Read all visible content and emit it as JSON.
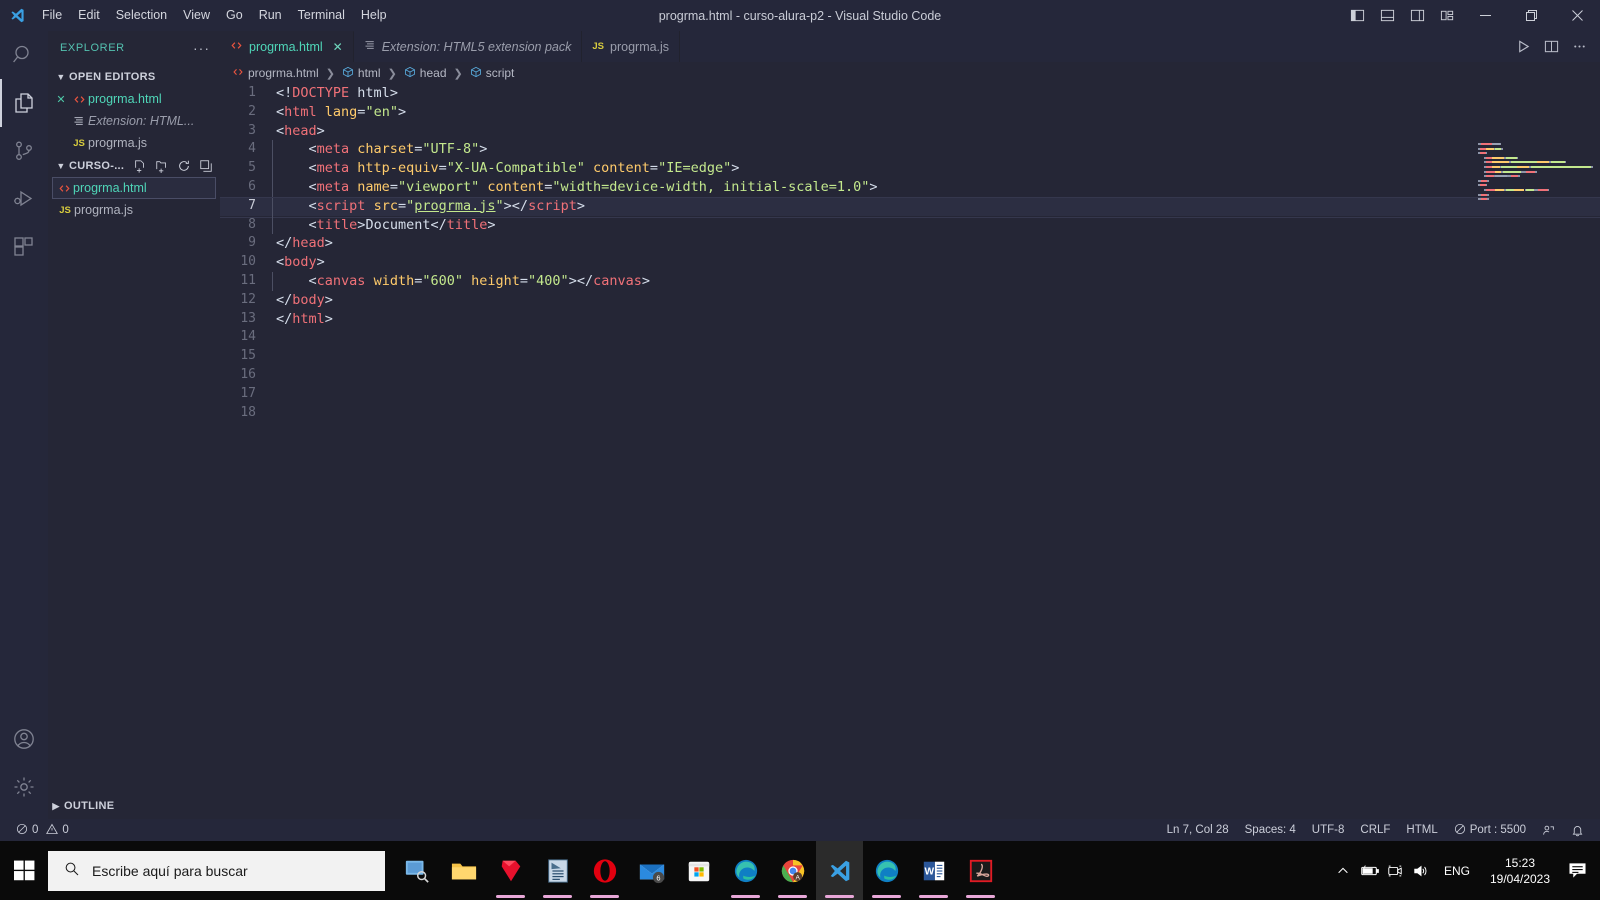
{
  "titlebar": {
    "title": "progrma.html - curso-alura-p2 - Visual Studio Code",
    "menu": [
      "File",
      "Edit",
      "Selection",
      "View",
      "Go",
      "Run",
      "Terminal",
      "Help"
    ],
    "layout_icons": [
      "toggle-primary-sidebar-icon",
      "toggle-panel-icon",
      "toggle-secondary-sidebar-icon",
      "customize-layout-icon"
    ],
    "window_controls": {
      "minimize": "—",
      "maximize": "❐",
      "close": "✕"
    }
  },
  "activitybar": {
    "items": [
      {
        "name": "search-icon",
        "label": "Search"
      },
      {
        "name": "explorer-icon",
        "label": "Explorer"
      },
      {
        "name": "source-control-icon",
        "label": "Source Control"
      },
      {
        "name": "run-and-debug-icon",
        "label": "Run and Debug"
      },
      {
        "name": "extensions-icon",
        "label": "Extensions"
      }
    ],
    "bottom": [
      {
        "name": "accounts-icon",
        "label": "Accounts"
      },
      {
        "name": "manage-settings-icon",
        "label": "Manage"
      }
    ]
  },
  "sidebar": {
    "header": "EXPLORER",
    "more_actions": "···",
    "open_editors": {
      "label": "OPEN EDITORS",
      "items": [
        {
          "name": "progrma.html",
          "icon": "html5-icon",
          "closable": true,
          "style": "html"
        },
        {
          "name": "Extension: HTML...",
          "icon": "extension-icon",
          "closable": false,
          "style": "ext"
        },
        {
          "name": "progrma.js",
          "icon": "js-icon",
          "closable": false,
          "style": "js"
        }
      ]
    },
    "folder": {
      "label": "CURSO-...",
      "actions": [
        "new-file-icon",
        "new-folder-icon",
        "refresh-icon",
        "collapse-all-icon"
      ],
      "files": [
        {
          "name": "progrma.html",
          "icon": "html5-icon",
          "selected": true,
          "style": "html"
        },
        {
          "name": "progrma.js",
          "icon": "js-icon",
          "selected": false,
          "style": "js"
        }
      ]
    },
    "outline": "OUTLINE"
  },
  "tabs": [
    {
      "label": "progrma.html",
      "icon": "html5-icon",
      "active": true,
      "dirty": false,
      "closable": true,
      "italic": false
    },
    {
      "label": "Extension: HTML5 extension pack",
      "icon": "extension-icon",
      "active": false,
      "closable": false,
      "italic": true
    },
    {
      "label": "progrma.js",
      "icon": "js-icon",
      "active": false,
      "closable": false,
      "italic": false
    }
  ],
  "tab_actions": [
    "run-code-icon",
    "split-editor-right-icon",
    "more-actions-icon"
  ],
  "breadcrumb": [
    {
      "label": "progrma.html",
      "icon": "html5-icon"
    },
    {
      "label": "html",
      "icon": "symbol-field-icon"
    },
    {
      "label": "head",
      "icon": "symbol-field-icon"
    },
    {
      "label": "script",
      "icon": "symbol-field-icon"
    }
  ],
  "code": {
    "active_line": 7,
    "lines": [
      {
        "n": 1,
        "tokens": [
          {
            "t": "punct",
            "v": "<!"
          },
          {
            "t": "doct",
            "v": "DOCTYPE"
          },
          {
            "t": "txt",
            "v": " html"
          },
          {
            "t": "punct",
            "v": ">"
          }
        ]
      },
      {
        "n": 2,
        "tokens": [
          {
            "t": "punct",
            "v": "<"
          },
          {
            "t": "tag",
            "v": "html"
          },
          {
            "t": "attr",
            "v": " lang"
          },
          {
            "t": "punct",
            "v": "="
          },
          {
            "t": "str",
            "v": "\"en\""
          },
          {
            "t": "punct",
            "v": ">"
          }
        ]
      },
      {
        "n": 3,
        "tokens": [
          {
            "t": "punct",
            "v": "<"
          },
          {
            "t": "tag",
            "v": "head"
          },
          {
            "t": "punct",
            "v": ">"
          }
        ]
      },
      {
        "n": 4,
        "indent": 1,
        "tokens": [
          {
            "t": "txt",
            "v": "    "
          },
          {
            "t": "punct",
            "v": "<"
          },
          {
            "t": "tag",
            "v": "meta"
          },
          {
            "t": "attr",
            "v": " charset"
          },
          {
            "t": "punct",
            "v": "="
          },
          {
            "t": "str",
            "v": "\"UTF-8\""
          },
          {
            "t": "punct",
            "v": ">"
          }
        ]
      },
      {
        "n": 5,
        "indent": 1,
        "tokens": [
          {
            "t": "txt",
            "v": "    "
          },
          {
            "t": "punct",
            "v": "<"
          },
          {
            "t": "tag",
            "v": "meta"
          },
          {
            "t": "attr",
            "v": " http-equiv"
          },
          {
            "t": "punct",
            "v": "="
          },
          {
            "t": "str",
            "v": "\"X-UA-Compatible\""
          },
          {
            "t": "attr",
            "v": " content"
          },
          {
            "t": "punct",
            "v": "="
          },
          {
            "t": "str",
            "v": "\"IE=edge\""
          },
          {
            "t": "punct",
            "v": ">"
          }
        ]
      },
      {
        "n": 6,
        "indent": 1,
        "tokens": [
          {
            "t": "txt",
            "v": "    "
          },
          {
            "t": "punct",
            "v": "<"
          },
          {
            "t": "tag",
            "v": "meta"
          },
          {
            "t": "attr",
            "v": " name"
          },
          {
            "t": "punct",
            "v": "="
          },
          {
            "t": "str",
            "v": "\"viewport\""
          },
          {
            "t": "attr",
            "v": " content"
          },
          {
            "t": "punct",
            "v": "="
          },
          {
            "t": "str",
            "v": "\"width=device-width, initial-scale=1.0\""
          },
          {
            "t": "punct",
            "v": ">"
          }
        ]
      },
      {
        "n": 7,
        "indent": 1,
        "tokens": [
          {
            "t": "txt",
            "v": "    "
          },
          {
            "t": "punct",
            "v": "<"
          },
          {
            "t": "tag",
            "v": "script"
          },
          {
            "t": "attr",
            "v": " src"
          },
          {
            "t": "punct",
            "v": "="
          },
          {
            "t": "str",
            "v": "\""
          },
          {
            "t": "link",
            "v": "progrma.js"
          },
          {
            "t": "str",
            "v": "\""
          },
          {
            "t": "punct",
            "v": ">"
          },
          {
            "t": "punct",
            "v": "</"
          },
          {
            "t": "tag",
            "v": "script"
          },
          {
            "t": "punct",
            "v": ">"
          }
        ]
      },
      {
        "n": 8,
        "indent": 1,
        "tokens": [
          {
            "t": "txt",
            "v": "    "
          },
          {
            "t": "punct",
            "v": "<"
          },
          {
            "t": "tag",
            "v": "title"
          },
          {
            "t": "punct",
            "v": ">"
          },
          {
            "t": "txt",
            "v": "Document"
          },
          {
            "t": "punct",
            "v": "</"
          },
          {
            "t": "tag",
            "v": "title"
          },
          {
            "t": "punct",
            "v": ">"
          }
        ]
      },
      {
        "n": 9,
        "tokens": [
          {
            "t": "punct",
            "v": "</"
          },
          {
            "t": "tag",
            "v": "head"
          },
          {
            "t": "punct",
            "v": ">"
          }
        ]
      },
      {
        "n": 10,
        "tokens": [
          {
            "t": "punct",
            "v": "<"
          },
          {
            "t": "tag",
            "v": "body"
          },
          {
            "t": "punct",
            "v": ">"
          }
        ]
      },
      {
        "n": 11,
        "indent": 1,
        "tokens": [
          {
            "t": "txt",
            "v": "    "
          },
          {
            "t": "punct",
            "v": "<"
          },
          {
            "t": "tag",
            "v": "canvas"
          },
          {
            "t": "attr",
            "v": " width"
          },
          {
            "t": "punct",
            "v": "="
          },
          {
            "t": "str",
            "v": "\"600\""
          },
          {
            "t": "attr",
            "v": " height"
          },
          {
            "t": "punct",
            "v": "="
          },
          {
            "t": "str",
            "v": "\"400\""
          },
          {
            "t": "punct",
            "v": ">"
          },
          {
            "t": "punct",
            "v": "</"
          },
          {
            "t": "tag",
            "v": "canvas"
          },
          {
            "t": "punct",
            "v": ">"
          }
        ]
      },
      {
        "n": 12,
        "tokens": [
          {
            "t": "punct",
            "v": "</"
          },
          {
            "t": "tag",
            "v": "body"
          },
          {
            "t": "punct",
            "v": ">"
          }
        ]
      },
      {
        "n": 13,
        "tokens": [
          {
            "t": "punct",
            "v": "</"
          },
          {
            "t": "tag",
            "v": "html"
          },
          {
            "t": "punct",
            "v": ">"
          }
        ]
      },
      {
        "n": 14,
        "tokens": []
      },
      {
        "n": 15,
        "tokens": []
      },
      {
        "n": 16,
        "tokens": []
      },
      {
        "n": 17,
        "tokens": []
      },
      {
        "n": 18,
        "tokens": []
      }
    ]
  },
  "statusbar": {
    "errors": "0",
    "warnings": "0",
    "position": "Ln 7, Col 28",
    "spaces": "Spaces: 4",
    "encoding": "UTF-8",
    "eol": "CRLF",
    "language": "HTML",
    "live_server": "Port : 5500",
    "remote_icon": "remote-window-icon",
    "bell_icon": "notifications-bell-icon"
  },
  "taskbar": {
    "start": "windows-start-icon",
    "search_placeholder": "Escribe aquí para buscar",
    "apps": [
      {
        "name": "task-view-icon",
        "running": false,
        "focused": false
      },
      {
        "name": "file-explorer-icon",
        "running": false,
        "focused": false
      },
      {
        "name": "sketchup-icon",
        "running": true,
        "focused": false
      },
      {
        "name": "layout-icon",
        "running": true,
        "focused": false
      },
      {
        "name": "opera-icon",
        "running": true,
        "focused": false
      },
      {
        "name": "mail-icon",
        "running": false,
        "focused": false,
        "badge": "6"
      },
      {
        "name": "microsoft-store-icon",
        "running": false,
        "focused": false
      },
      {
        "name": "edge-icon",
        "running": true,
        "focused": false
      },
      {
        "name": "chrome-icon",
        "running": true,
        "focused": false
      },
      {
        "name": "vscode-icon",
        "running": true,
        "focused": true
      },
      {
        "name": "edge-icon",
        "running": true,
        "focused": false
      },
      {
        "name": "word-icon",
        "running": true,
        "focused": false
      },
      {
        "name": "acrobat-reader-icon",
        "running": true,
        "focused": false
      }
    ],
    "tray": {
      "chevron": "show-hidden-icons-icon",
      "battery": "battery-charging-icon",
      "camera": "camera-icon",
      "volume": "volume-icon",
      "language": "ENG",
      "time": "15:23",
      "date": "19/04/2023",
      "notifications": "action-center-icon"
    }
  },
  "colors": {
    "titlebar_bg": "#25273a",
    "editor_bg": "#252636",
    "accent_teal": "#4fd6b8",
    "tag_red": "#f07178",
    "attr_yellow": "#ffcb6b",
    "string_green": "#c3e88d",
    "taskbar_bg": "#0a0a0a",
    "running_underline": "#e8a7d8"
  }
}
